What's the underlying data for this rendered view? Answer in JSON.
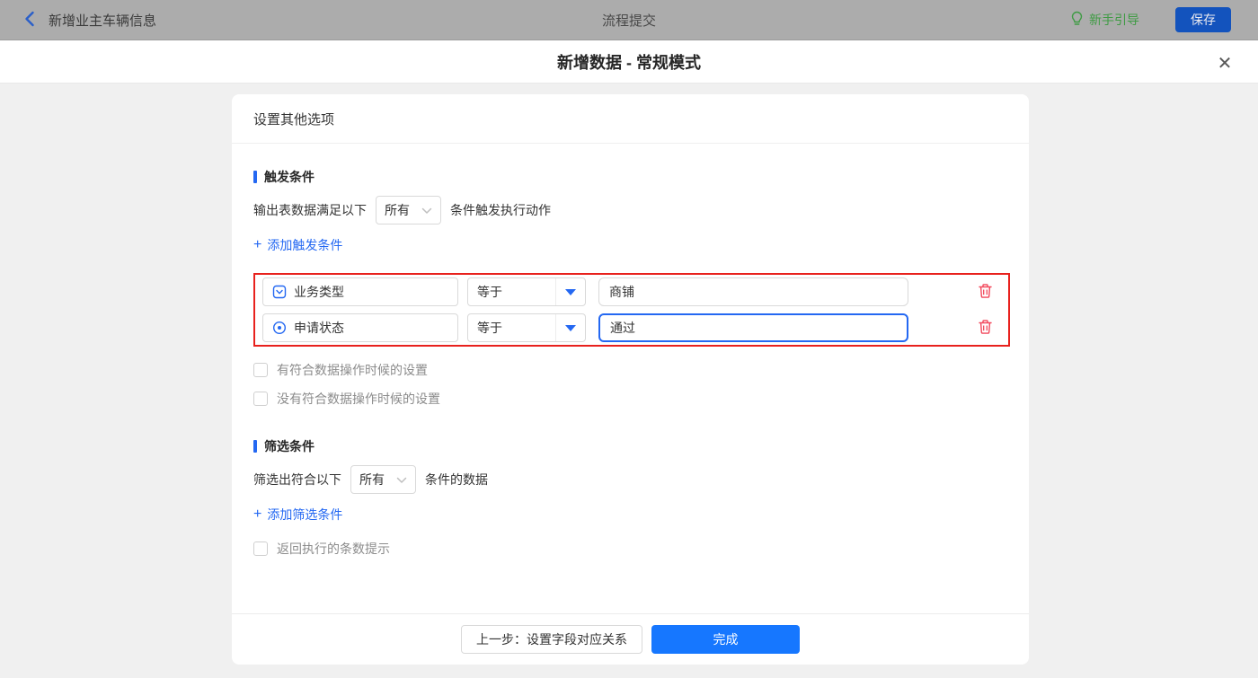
{
  "topbar": {
    "back_title": "新增业主车辆信息",
    "center_title": "流程提交",
    "guide_label": "新手引导",
    "save_label": "保存"
  },
  "modal": {
    "title": "新增数据 - 常规模式",
    "close_glyph": "✕"
  },
  "card": {
    "header": "设置其他选项",
    "trigger_section": {
      "title": "触发条件",
      "sentence_prefix": "输出表数据满足以下",
      "match_select_value": "所有",
      "sentence_suffix": "条件触发执行动作",
      "plus": "+",
      "add_link": "添加触发条件",
      "conditions": [
        {
          "field": "业务类型",
          "field_type": "dropdown",
          "operator": "等于",
          "value": "商铺",
          "focused": false
        },
        {
          "field": "申请状态",
          "field_type": "radio",
          "operator": "等于",
          "value": "通过",
          "focused": true
        }
      ],
      "checkboxes": [
        "有符合数据操作时候的设置",
        "没有符合数据操作时候的设置"
      ]
    },
    "filter_section": {
      "title": "筛选条件",
      "sentence_prefix": "筛选出符合以下",
      "match_select_value": "所有",
      "sentence_suffix": "条件的数据",
      "plus": "+",
      "add_link": "添加筛选条件",
      "checkbox": "返回执行的条数提示"
    },
    "footer": {
      "prev_label": "上一步：设置字段对应关系",
      "done_label": "完成"
    }
  },
  "colors": {
    "accent_blue": "#2468f2",
    "done_button_blue": "#1677ff",
    "annotation_red": "#e8211d",
    "trash_red": "#f2495c",
    "guide_green": "#3f9b44",
    "topbar_gray": "#acacac",
    "body_gray": "#f0f0f0"
  }
}
